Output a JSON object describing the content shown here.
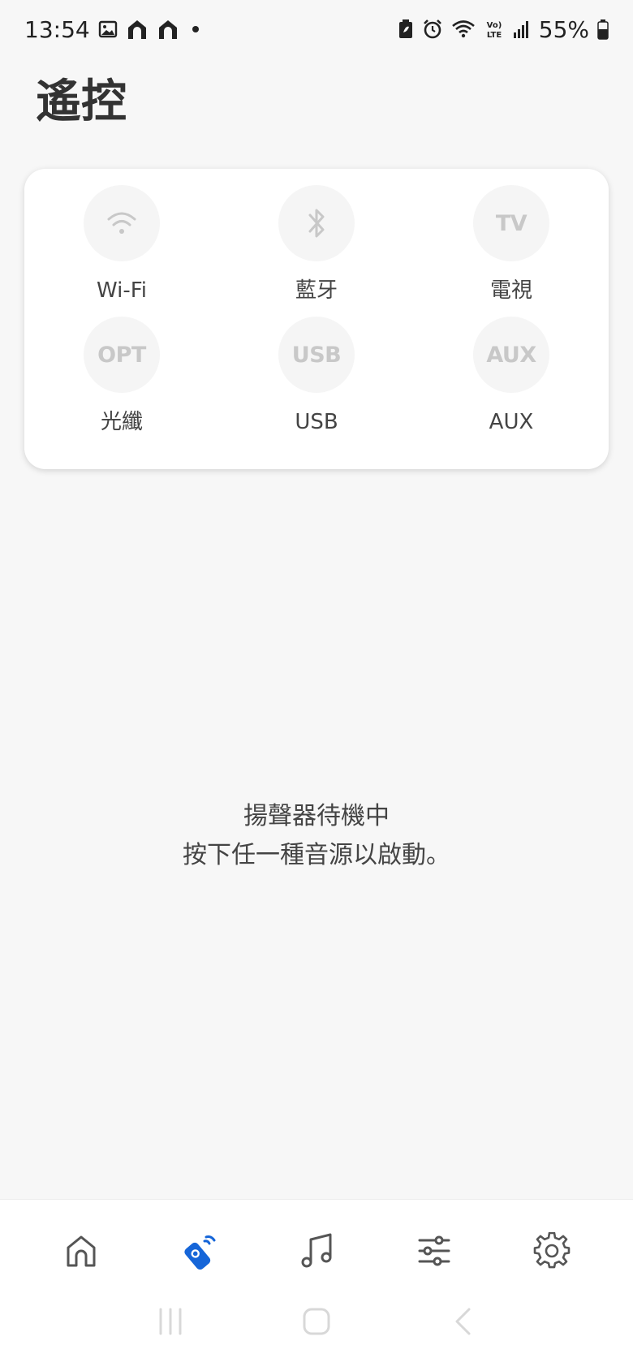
{
  "status_bar": {
    "time": "13:54",
    "battery_percent": "55%",
    "left_icons": [
      "image-icon",
      "home-app-icon",
      "home-app-icon",
      "dot-icon"
    ],
    "right_icons": [
      "battery-saver-icon",
      "alarm-icon",
      "wifi-icon",
      "volte-icon",
      "signal-icon",
      "battery-icon"
    ]
  },
  "page": {
    "title": "遙控"
  },
  "sources": [
    {
      "label": "Wi-Fi",
      "icon": "wifi-icon",
      "glyph": ""
    },
    {
      "label": "藍牙",
      "icon": "bluetooth-icon",
      "glyph": ""
    },
    {
      "label": "電視",
      "icon": "tv-icon",
      "glyph": "TV"
    },
    {
      "label": "光纖",
      "icon": "optical-icon",
      "glyph": "OPT"
    },
    {
      "label": "USB",
      "icon": "usb-icon",
      "glyph": "USB"
    },
    {
      "label": "AUX",
      "icon": "aux-icon",
      "glyph": "AUX"
    }
  ],
  "standby": {
    "line1": "揚聲器待機中",
    "line2": "按下任一種音源以啟動。"
  },
  "bottom_nav": {
    "items": [
      "home-icon",
      "remote-icon",
      "music-icon",
      "equalizer-icon",
      "settings-icon"
    ],
    "active_index": 1,
    "active_color": "#1565d8",
    "inactive_color": "#555555"
  },
  "system_nav": [
    "recents-button",
    "home-button",
    "back-button"
  ]
}
